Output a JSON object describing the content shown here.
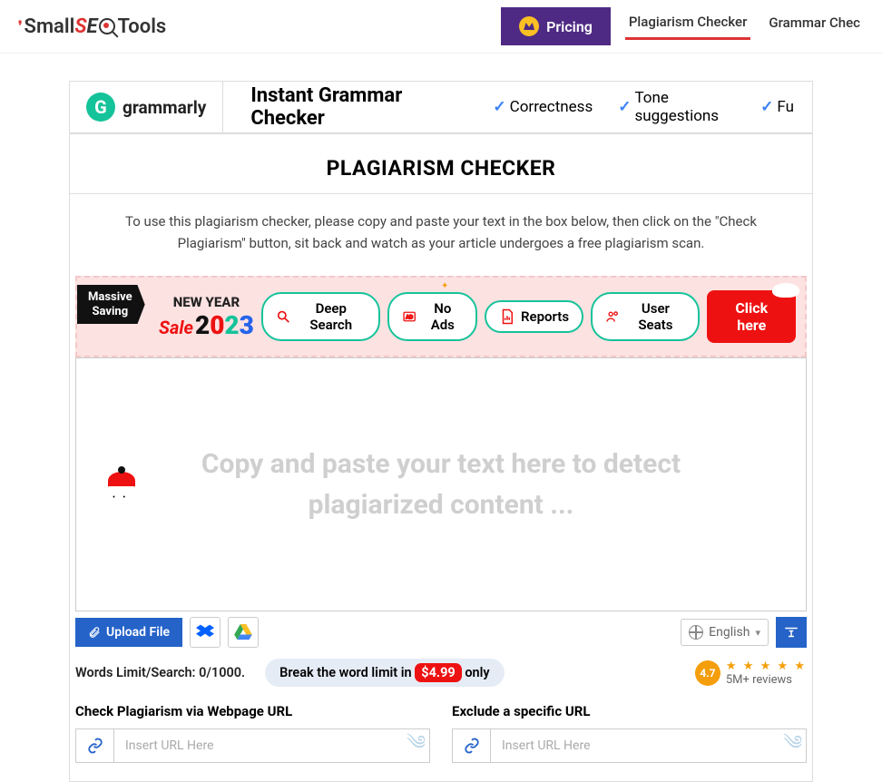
{
  "header": {
    "logo_text": "SmallSEOTools",
    "pricing_label": "Pricing",
    "nav": [
      {
        "label": "Plagiarism Checker",
        "active": true
      },
      {
        "label": "Grammar Chec",
        "active": false
      }
    ]
  },
  "ad": {
    "brand": "grammarly",
    "title": "Instant Grammar Checker",
    "checks": [
      "Correctness",
      "Tone suggestions",
      "Fu"
    ]
  },
  "page": {
    "title": "PLAGIARISM CHECKER",
    "instructions": "To use this plagiarism checker, please copy and paste your text in the box below, then click on the \"Check Plagiarism\" button, sit back and watch as your article undergoes a free plagiarism scan."
  },
  "promo": {
    "badge_line1": "Massive",
    "badge_line2": "Saving",
    "newyear": "NEW YEAR",
    "sale": "Sale",
    "year": "2023",
    "pills": [
      "Deep Search",
      "No Ads",
      "Reports",
      "User Seats"
    ],
    "cta": "Click here"
  },
  "editor": {
    "placeholder": "Copy and paste your text here to detect plagiarized content ..."
  },
  "toolbar": {
    "upload_label": "Upload File",
    "language": "English"
  },
  "limits": {
    "words_text": "Words Limit/Search: 0/1000.",
    "break_prefix": "Break the word limit in ",
    "price": "$4.99",
    "break_suffix": " only"
  },
  "rating": {
    "score": "4.7",
    "reviews": "5M+ reviews"
  },
  "urls": {
    "check_label": "Check Plagiarism via Webpage URL",
    "exclude_label": "Exclude a specific URL",
    "placeholder": "Insert URL Here"
  }
}
